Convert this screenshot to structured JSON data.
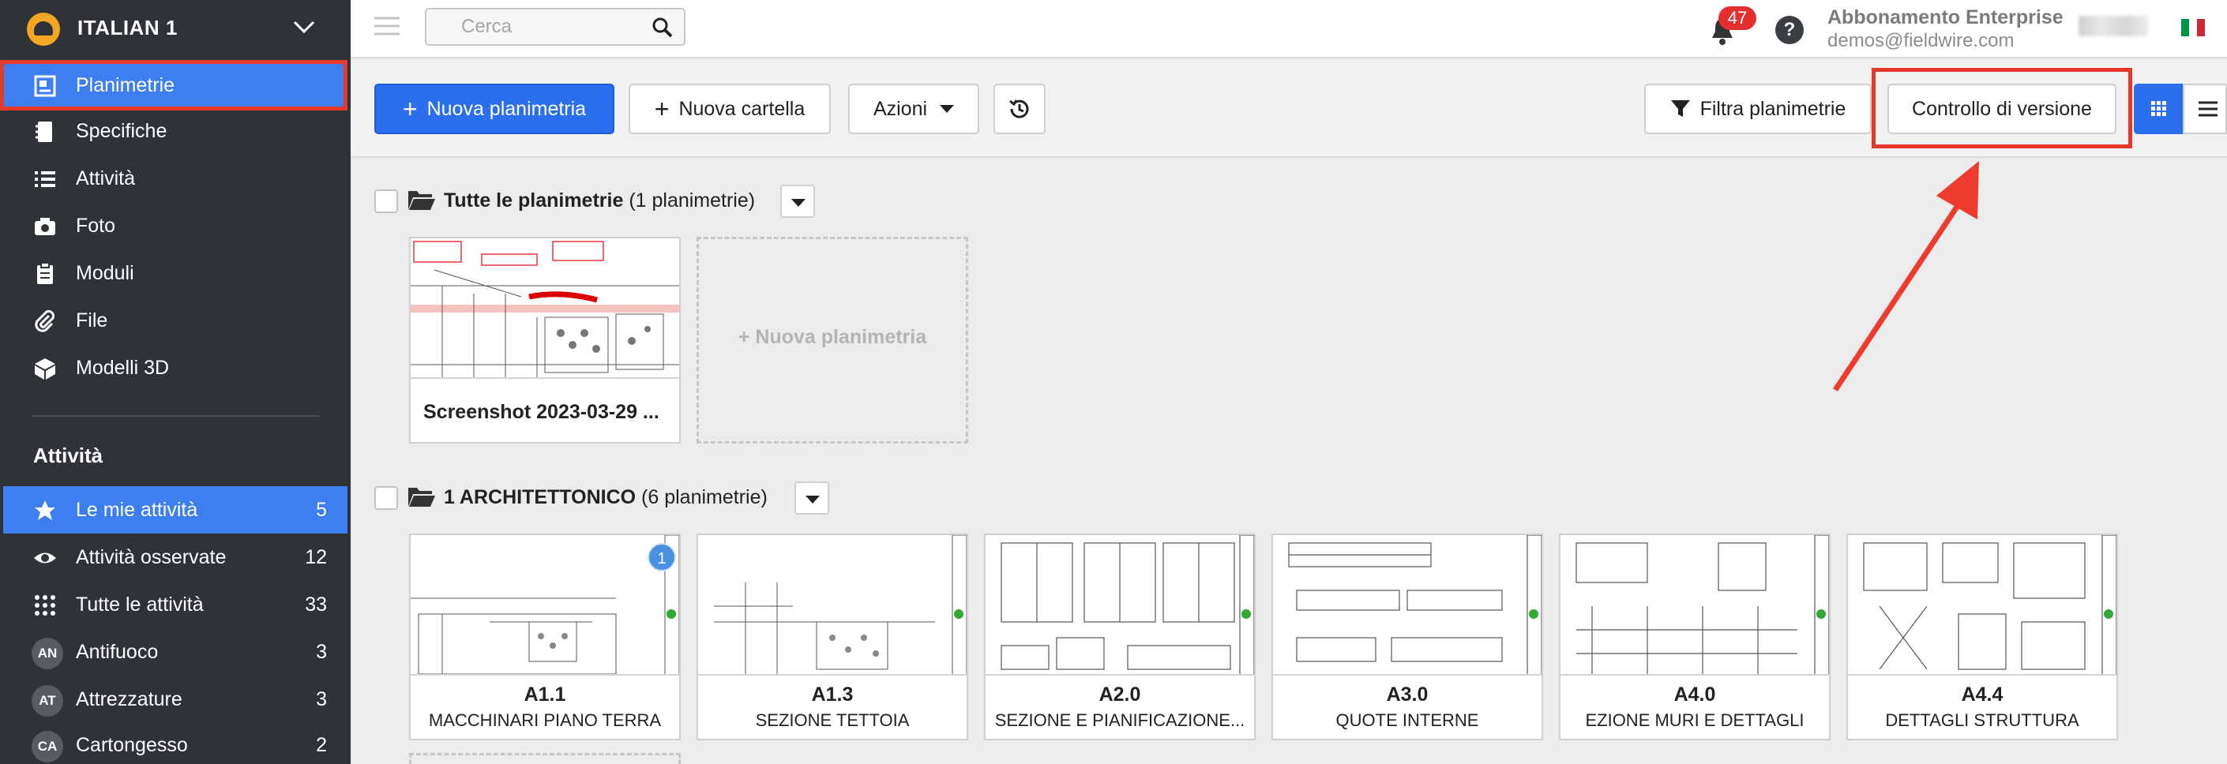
{
  "sidebar": {
    "project": "ITALIAN 1",
    "nav": [
      {
        "label": "Planimetrie",
        "icon": "plans-icon"
      },
      {
        "label": "Specifiche",
        "icon": "specs-icon"
      },
      {
        "label": "Attività",
        "icon": "list-icon"
      },
      {
        "label": "Foto",
        "icon": "camera-icon"
      },
      {
        "label": "Moduli",
        "icon": "clipboard-icon"
      },
      {
        "label": "File",
        "icon": "paperclip-icon"
      },
      {
        "label": "Modelli 3D",
        "icon": "cube-icon"
      }
    ],
    "tasks_title": "Attività",
    "tasks": [
      {
        "label": "Le mie attività",
        "count": "5",
        "icon": "star-icon"
      },
      {
        "label": "Attività osservate",
        "count": "12",
        "icon": "eye-icon"
      },
      {
        "label": "Tutte le attività",
        "count": "33",
        "icon": "grid-dots-icon"
      },
      {
        "label": "Antifuoco",
        "count": "3",
        "avatar": "AN"
      },
      {
        "label": "Attrezzature",
        "count": "3",
        "avatar": "AT"
      },
      {
        "label": "Cartongesso",
        "count": "2",
        "avatar": "CA"
      }
    ]
  },
  "topbar": {
    "search_placeholder": "Cerca",
    "notifications": "47",
    "help": "?",
    "plan": "Abbonamento Enterprise",
    "email": "demos@fieldwire.com",
    "flag_colors": [
      "#009246",
      "#ffffff",
      "#ce2b37"
    ]
  },
  "toolbar": {
    "new_plan": "Nuova planimetria",
    "new_folder": "Nuova cartella",
    "actions": "Azioni",
    "filter": "Filtra planimetrie",
    "version_control": "Controllo di versione"
  },
  "folders": [
    {
      "name": "Tutte le planimetrie",
      "count": "(1 planimetrie)",
      "cards": [
        {
          "title": "Screenshot 2023-03-29 ..."
        }
      ],
      "placeholder": "+ Nuova planimetria"
    },
    {
      "name": "1 ARCHITETTONICO",
      "count": "(6 planimetrie)",
      "cards": [
        {
          "code": "A1.1",
          "desc": "MACCHINARI PIANO TERRA",
          "badge": "1"
        },
        {
          "code": "A1.3",
          "desc": "SEZIONE TETTOIA"
        },
        {
          "code": "A2.0",
          "desc": "SEZIONE E PIANIFICAZIONE..."
        },
        {
          "code": "A3.0",
          "desc": "QUOTE INTERNE"
        },
        {
          "code": "A4.0",
          "desc": "EZIONE MURI E DETTAGLI"
        },
        {
          "code": "A4.4",
          "desc": "DETTAGLI STRUTTURA"
        }
      ]
    }
  ],
  "colors": {
    "accent": "#2b6fee",
    "highlight": "#e5382b",
    "sidebar": "#2f3237"
  }
}
